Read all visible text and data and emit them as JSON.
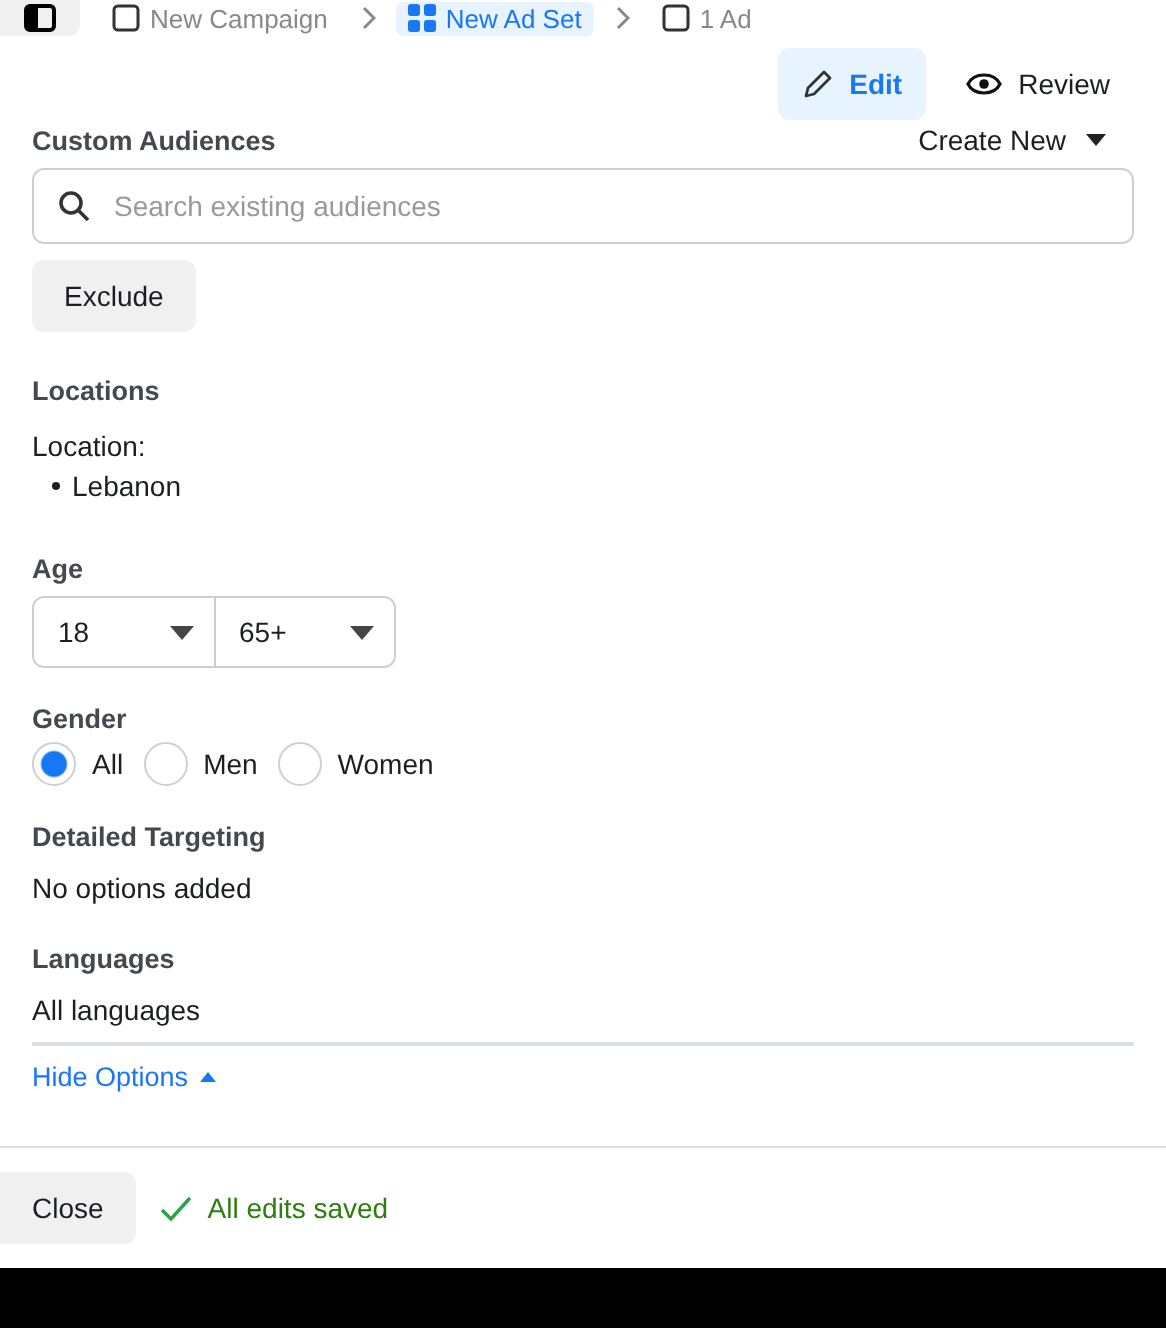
{
  "breadcrumb": [
    {
      "label": "New Campaign",
      "kind": "campaign",
      "selected": false
    },
    {
      "label": "New Ad Set",
      "kind": "adset",
      "selected": true
    },
    {
      "label": "1 Ad",
      "kind": "ad",
      "selected": false
    }
  ],
  "mode_tabs": [
    {
      "label": "Edit",
      "kind": "edit",
      "selected": true
    },
    {
      "label": "Review",
      "kind": "review",
      "selected": false
    }
  ],
  "custom_audiences": {
    "title": "Custom Audiences",
    "create_new": "Create New",
    "search": {
      "placeholder": "Search existing audiences"
    },
    "exclude": "Exclude"
  },
  "locations": {
    "title": "Locations",
    "label": "Location:",
    "items": [
      "Lebanon"
    ]
  },
  "age": {
    "title": "Age",
    "min": "18",
    "max": "65+"
  },
  "gender": {
    "title": "Gender",
    "options": [
      {
        "label": "All",
        "selected": true
      },
      {
        "label": "Men",
        "selected": false
      },
      {
        "label": "Women",
        "selected": false
      }
    ]
  },
  "detailed_targeting": {
    "title": "Detailed Targeting",
    "value": "No options added"
  },
  "languages": {
    "title": "Languages",
    "value": "All languages"
  },
  "hide_options": "Hide Options",
  "footer": {
    "close": "Close",
    "status": "All edits saved"
  }
}
